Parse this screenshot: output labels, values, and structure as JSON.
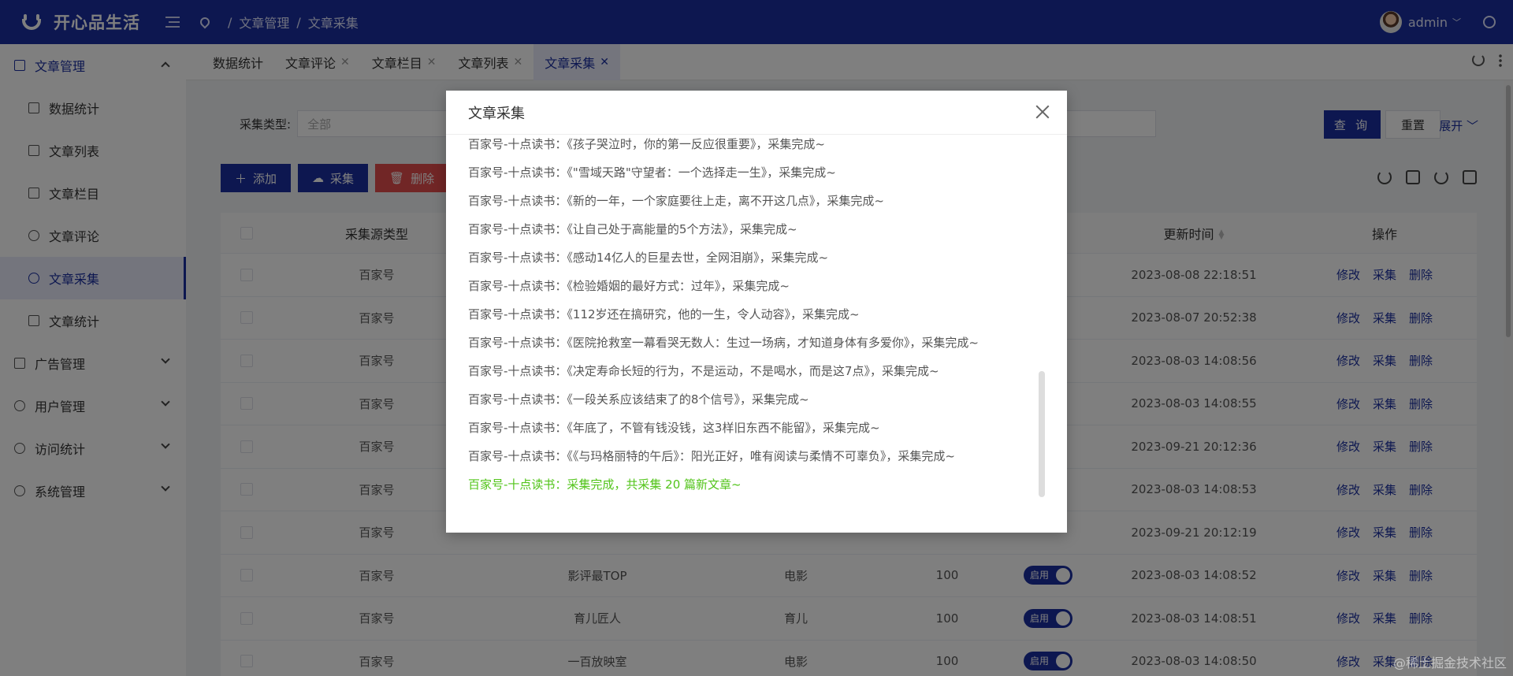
{
  "app": {
    "title": "开心品生活"
  },
  "breadcrumb": {
    "items": [
      "文章管理",
      "文章采集"
    ]
  },
  "user": {
    "name": "admin"
  },
  "sidebar": {
    "groups": [
      {
        "label": "文章管理",
        "expanded": true,
        "icon": "document-icon"
      },
      {
        "label": "广告管理",
        "icon": "image-icon"
      },
      {
        "label": "用户管理",
        "icon": "user-icon"
      },
      {
        "label": "访问统计",
        "icon": "stats-icon"
      },
      {
        "label": "系统管理",
        "icon": "gear-icon"
      }
    ],
    "sub_items": [
      "数据统计",
      "文章列表",
      "文章栏目",
      "文章评论",
      "文章采集",
      "文章统计"
    ],
    "selected": "文章采集"
  },
  "tabs": [
    {
      "label": "数据统计",
      "closable": false
    },
    {
      "label": "文章评论",
      "closable": true
    },
    {
      "label": "文章栏目",
      "closable": true
    },
    {
      "label": "文章列表",
      "closable": true
    },
    {
      "label": "文章采集",
      "closable": true,
      "active": true
    }
  ],
  "search": {
    "label": "采集类型:",
    "placeholder": "全部",
    "query": "查 询",
    "reset": "重置",
    "expand": "展开"
  },
  "toolbar": {
    "add": "添加",
    "collect": "采集",
    "delete": "删除"
  },
  "table": {
    "headers": {
      "source": "采集源类型",
      "time": "更新时间",
      "ops": "操作"
    },
    "ops": [
      "修改",
      "采集",
      "删除"
    ],
    "status_label": "启用",
    "rows": [
      {
        "source": "百家号",
        "name": "",
        "category": "",
        "sort": "",
        "time": "2023-08-08 22:18:51"
      },
      {
        "source": "百家号",
        "name": "",
        "category": "",
        "sort": "",
        "time": "2023-08-07 20:52:38"
      },
      {
        "source": "百家号",
        "name": "",
        "category": "",
        "sort": "",
        "time": "2023-08-03 14:08:56"
      },
      {
        "source": "百家号",
        "name": "",
        "category": "",
        "sort": "",
        "time": "2023-08-03 14:08:55"
      },
      {
        "source": "百家号",
        "name": "",
        "category": "",
        "sort": "",
        "time": "2023-09-21 20:12:36"
      },
      {
        "source": "百家号",
        "name": "",
        "category": "",
        "sort": "",
        "time": "2023-08-03 14:08:53"
      },
      {
        "source": "百家号",
        "name": "",
        "category": "",
        "sort": "",
        "time": "2023-09-21 20:12:19"
      },
      {
        "source": "百家号",
        "name": "影评最TOP",
        "category": "电影",
        "sort": "100",
        "time": "2023-08-03 14:08:52"
      },
      {
        "source": "百家号",
        "name": "育儿匠人",
        "category": "育儿",
        "sort": "100",
        "time": "2023-08-03 14:08:51"
      },
      {
        "source": "百家号",
        "name": "一百放映室",
        "category": "电影",
        "sort": "100",
        "time": "2023-08-03 14:08:50"
      }
    ]
  },
  "dialog": {
    "title": "文章采集",
    "log": [
      "百家号-十点读书：《孩子哭泣时，你的第一反应很重要》，采集完成~",
      "百家号-十点读书：《\"雪域天路\"守望者：一个选择走一生》，采集完成~",
      "百家号-十点读书：《新的一年，一个家庭要往上走，离不开这几点》，采集完成~",
      "百家号-十点读书：《让自己处于高能量的5个方法》，采集完成~",
      "百家号-十点读书：《感动14亿人的巨星去世，全网泪崩》，采集完成~",
      "百家号-十点读书：《检验婚姻的最好方式：过年》，采集完成~",
      "百家号-十点读书：《112岁还在搞研究，他的一生，令人动容》，采集完成~",
      "百家号-十点读书：《医院抢救室一幕看哭无数人：生过一场病，才知道身体有多爱你》，采集完成~",
      "百家号-十点读书：《决定寿命长短的行为，不是运动，不是喝水，而是这7点》，采集完成~",
      "百家号-十点读书：《一段关系应该结束了的8个信号》，采集完成~",
      "百家号-十点读书：《年底了，不管有钱没钱，这3样旧东西不能留》，采集完成~",
      "百家号-十点读书：《《与玛格丽特的午后》：阳光正好，唯有阅读与柔情不可辜负》，采集完成~"
    ],
    "summary": "百家号-十点读书：采集完成，共采集 20 篇新文章~"
  },
  "watermark": "@稀土掘金技术社区",
  "colors": {
    "primary": "#1a2fa0",
    "danger": "#e24d4d",
    "success": "#52c41a"
  }
}
